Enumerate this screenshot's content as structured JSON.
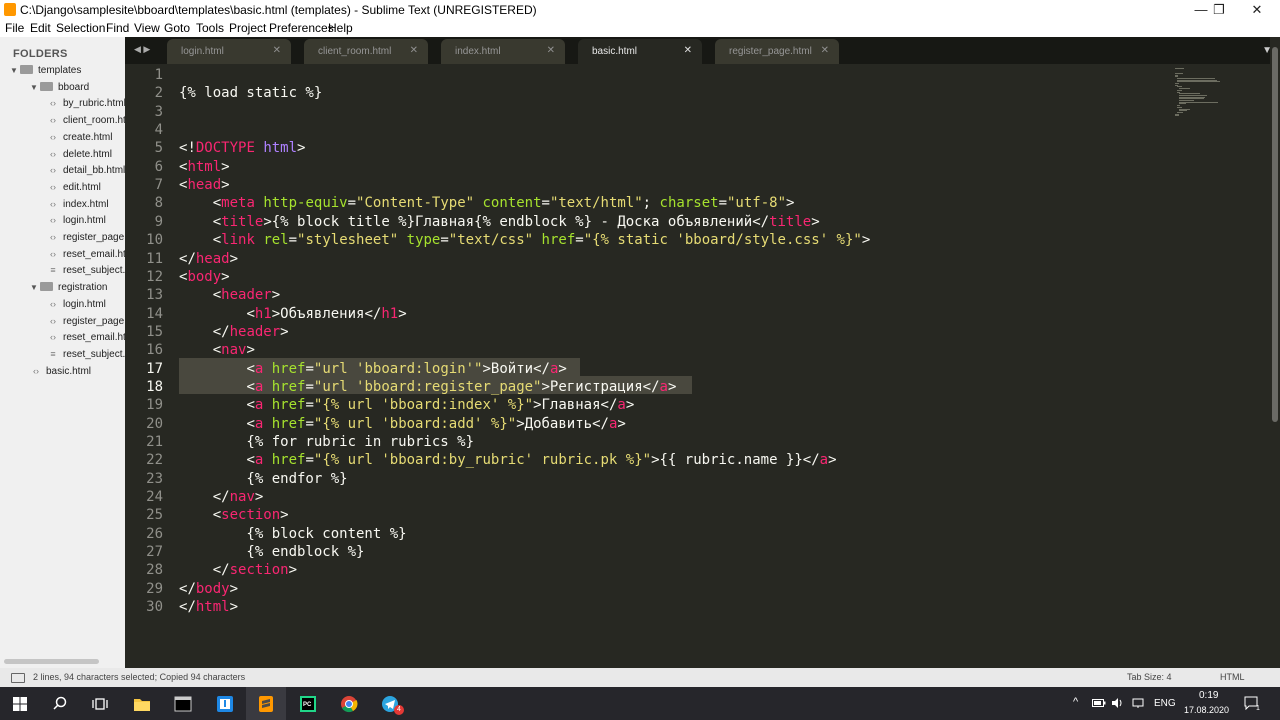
{
  "window": {
    "title": "C:\\Django\\samplesite\\bboard\\templates\\basic.html (templates) - Sublime Text (UNREGISTERED)",
    "minimize": "—",
    "maximize": "❐",
    "close": "✕"
  },
  "menu": [
    "File",
    "Edit",
    "Selection",
    "Find",
    "View",
    "Goto",
    "Tools",
    "Project",
    "Preferences",
    "Help"
  ],
  "sidebar": {
    "header": "FOLDERS",
    "items": [
      {
        "label": "templates",
        "type": "folder",
        "depth": 0
      },
      {
        "label": "bboard",
        "type": "folder",
        "depth": 1
      },
      {
        "label": "by_rubric.html",
        "type": "file",
        "depth": 2
      },
      {
        "label": "client_room.html",
        "type": "file",
        "depth": 2
      },
      {
        "label": "create.html",
        "type": "file",
        "depth": 2
      },
      {
        "label": "delete.html",
        "type": "file",
        "depth": 2
      },
      {
        "label": "detail_bb.html",
        "type": "file",
        "depth": 2
      },
      {
        "label": "edit.html",
        "type": "file",
        "depth": 2
      },
      {
        "label": "index.html",
        "type": "file",
        "depth": 2
      },
      {
        "label": "login.html",
        "type": "file",
        "depth": 2
      },
      {
        "label": "register_page.html",
        "type": "file",
        "depth": 2
      },
      {
        "label": "reset_email.html",
        "type": "file",
        "depth": 2
      },
      {
        "label": "reset_subject.txt",
        "type": "text",
        "depth": 2
      },
      {
        "label": "registration",
        "type": "folder",
        "depth": 1
      },
      {
        "label": "login.html",
        "type": "file",
        "depth": 2
      },
      {
        "label": "register_page.html",
        "type": "file",
        "depth": 2
      },
      {
        "label": "reset_email.html",
        "type": "file",
        "depth": 2
      },
      {
        "label": "reset_subject.txt",
        "type": "text",
        "depth": 2
      },
      {
        "label": "basic.html",
        "type": "file",
        "depth": 1
      }
    ]
  },
  "tabs": [
    {
      "label": "login.html",
      "active": false
    },
    {
      "label": "client_room.html",
      "active": false
    },
    {
      "label": "index.html",
      "active": false
    },
    {
      "label": "basic.html",
      "active": true
    },
    {
      "label": "register_page.html",
      "active": false
    }
  ],
  "tab_close": "✕",
  "tab_nav": "◀ ▶",
  "tab_menu": "▼",
  "editor": {
    "line_numbers": [
      "1",
      "2",
      "3",
      "4",
      "5",
      "6",
      "7",
      "8",
      "9",
      "10",
      "11",
      "12",
      "13",
      "14",
      "15",
      "16",
      "17",
      "18",
      "19",
      "20",
      "21",
      "22",
      "23",
      "24",
      "25",
      "26",
      "27",
      "28",
      "29",
      "30"
    ],
    "current_lines": [
      17,
      18
    ],
    "lines": [
      "",
      "{% load static %}",
      "",
      "",
      "<!DOCTYPE html>",
      "<html>",
      "<head>",
      "    <meta http-equiv=\"Content-Type\" content=\"text/html\"; charset=\"utf-8\">",
      "    <title>{% block title %}Главная{% endblock %} - Доска объявлений</title>",
      "    <link rel=\"stylesheet\" type=\"text/css\" href=\"{% static 'bboard/style.css' %}\">",
      "</head>",
      "<body>",
      "    <header>",
      "        <h1>Объявления</h1>",
      "    </header>",
      "    <nav>",
      "        <a href=\"url 'bboard:login'\">Войти</a>",
      "        <a href=\"url 'bboard:register_page\">Регистрация</a>",
      "        <a href=\"{% url 'bboard:index' %}\">Главная</a>",
      "        <a href=\"{% url 'bboard:add' %}\">Добавить</a>",
      "        {% for rubric in rubrics %}",
      "        <a href=\"{% url 'bboard:by_rubric' rubric.pk %}\">{{ rubric.name }}</a>",
      "        {% endfor %}",
      "    </nav>",
      "    <section>",
      "        {% block content %}",
      "        {% endblock %}",
      "    </section>",
      "</body>",
      "</html>"
    ]
  },
  "status": {
    "message": "2 lines, 94 characters selected; Copied 94 characters",
    "tab_size": "Tab Size: 4",
    "syntax": "HTML"
  },
  "taskbar": {
    "apps": [
      "start",
      "search",
      "task-view",
      "file-explorer",
      "terminal",
      "sublime-text",
      "pycharm",
      "chrome",
      "telegram"
    ],
    "telegram_badge": "4",
    "lang": "ENG",
    "time": "0:19",
    "date": "17.08.2020",
    "notif_count": "1",
    "tray_arrow": "^"
  },
  "colors": {
    "editor_bg": "#272822",
    "tag": "#f92672",
    "attr": "#a6e22e",
    "string": "#e6db74",
    "keyword": "#ae81ff",
    "text": "#f8f8f2",
    "selection": "#49483e"
  }
}
